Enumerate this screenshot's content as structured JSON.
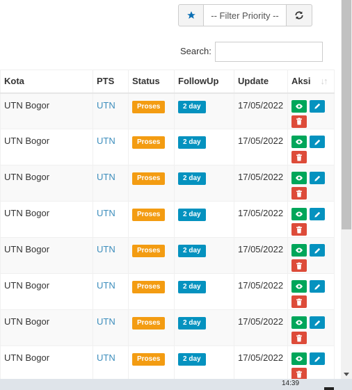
{
  "filter": {
    "icon": "star-icon",
    "priority_label": "-- Filter Priority --",
    "refresh_icon": "refresh-icon"
  },
  "search": {
    "label": "Search:",
    "value": ""
  },
  "table": {
    "headers": [
      "Kota",
      "PTS",
      "Status",
      "FollowUp",
      "Update",
      "Aksi"
    ],
    "rows": [
      {
        "kota": "UTN Bogor",
        "pts": "UTN",
        "status": "Proses",
        "followup": "2 day",
        "update": "17/05/2022"
      },
      {
        "kota": "UTN Bogor",
        "pts": "UTN",
        "status": "Proses",
        "followup": "2 day",
        "update": "17/05/2022"
      },
      {
        "kota": "UTN Bogor",
        "pts": "UTN",
        "status": "Proses",
        "followup": "2 day",
        "update": "17/05/2022"
      },
      {
        "kota": "UTN Bogor",
        "pts": "UTN",
        "status": "Proses",
        "followup": "2 day",
        "update": "17/05/2022"
      },
      {
        "kota": "UTN Bogor",
        "pts": "UTN",
        "status": "Proses",
        "followup": "2 day",
        "update": "17/05/2022"
      },
      {
        "kota": "UTN Bogor",
        "pts": "UTN",
        "status": "Proses",
        "followup": "2 day",
        "update": "17/05/2022"
      },
      {
        "kota": "UTN Bogor",
        "pts": "UTN",
        "status": "Proses",
        "followup": "2 day",
        "update": "17/05/2022"
      },
      {
        "kota": "UTN Bogor",
        "pts": "UTN",
        "status": "Proses",
        "followup": "2 day",
        "update": "17/05/2022"
      }
    ]
  },
  "taskbar": {
    "time": "14:39"
  },
  "colors": {
    "status_badge": "#f39c12",
    "followup_badge": "#0592bf",
    "view_button": "#00a65a",
    "edit_button": "#0592bf",
    "delete_button": "#dd4b39",
    "link": "#3c8dbc"
  }
}
